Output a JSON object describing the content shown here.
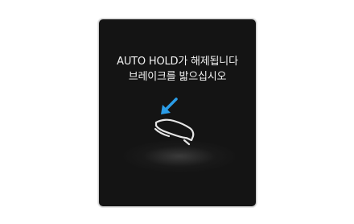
{
  "notification": {
    "line1": "AUTO HOLD가 해제됩니다",
    "line2": "브레이크를 밟으십시오"
  },
  "icons": {
    "arrow": "down-left-arrow-icon",
    "foot": "foot-on-brake-pedal-icon"
  },
  "colors": {
    "screen_background": "#141414",
    "text": "#f2f2f2",
    "arrow": "#2b9de8",
    "foot_outline": "#e6e6e6"
  }
}
